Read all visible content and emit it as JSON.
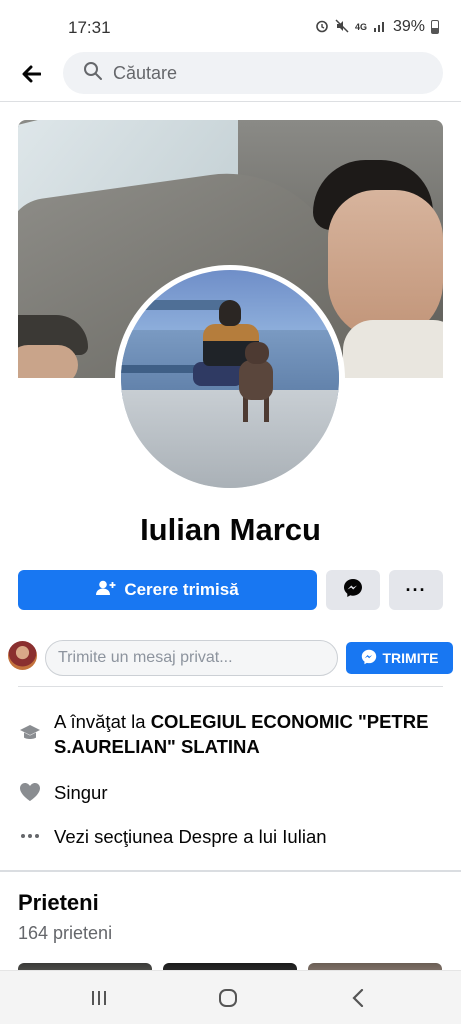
{
  "status_bar": {
    "time": "17:31",
    "network": "4G",
    "battery": "39%",
    "icons": [
      "alarm-icon",
      "mute-icon",
      "signal-icon",
      "battery-icon"
    ]
  },
  "header": {
    "search_placeholder": "Căutare",
    "back_icon": "back-arrow-icon"
  },
  "profile": {
    "name": "Iulian Marcu",
    "primary_button_label": "Cerere trimisă",
    "more_button_label": "···"
  },
  "message_row": {
    "placeholder": "Trimite un mesaj privat...",
    "send_label": "TRIMITE"
  },
  "intro": {
    "education_prefix": "A învăţat la ",
    "education_school": "COLEGIUL ECONOMIC \"PETRE S.AURELIAN\" SLATINA",
    "relationship": "Singur",
    "about_link": "Vezi secţiunea Despre a lui Iulian"
  },
  "friends": {
    "title": "Prieteni",
    "count": "164 prieteni"
  },
  "colors": {
    "primary": "#1877f2",
    "secondary_button": "#e4e6eb",
    "muted_text": "#65676b"
  }
}
